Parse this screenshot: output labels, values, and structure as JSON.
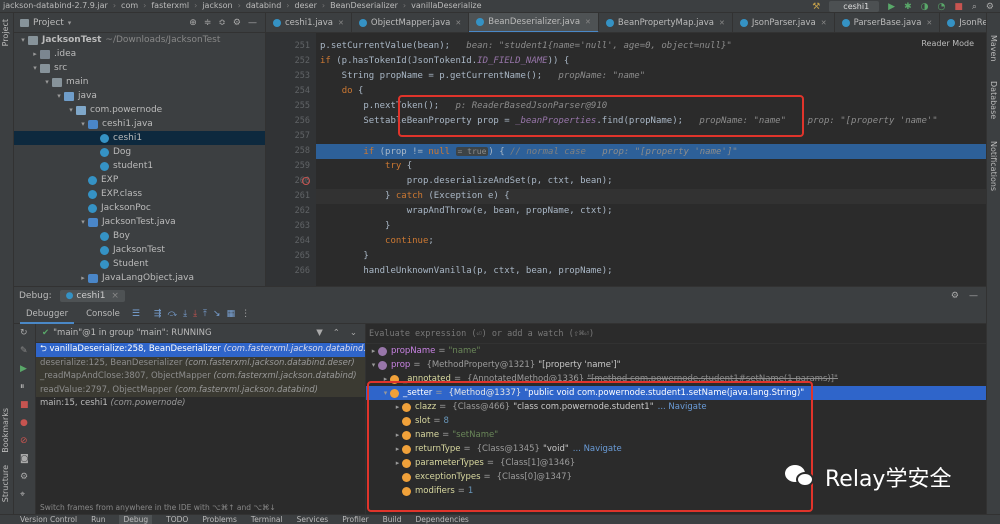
{
  "breadcrumb": [
    "jackson-databind-2.7.9.jar",
    "com",
    "fasterxml",
    "jackson",
    "databind",
    "deser",
    "BeanDeserializer",
    "vanillaDeserialize"
  ],
  "toolbar": {
    "run_config": "ceshi1"
  },
  "left_strip": {
    "project_label": "Project",
    "bookmarks_label": "Bookmarks",
    "structure_label": "Structure"
  },
  "right_strip": {
    "maven_label": "Maven",
    "database_label": "Database",
    "notifications_label": "Notifications"
  },
  "project": {
    "title": "Project",
    "tree": [
      {
        "label": "JacksonTest",
        "suffix": "~/Downloads/JacksonTest",
        "indent": 0,
        "arrow": "▾",
        "icon": "folder"
      },
      {
        "label": ".idea",
        "indent": 1,
        "arrow": "▸",
        "icon": "folder-idea"
      },
      {
        "label": "src",
        "indent": 1,
        "arrow": "▾",
        "icon": "folder"
      },
      {
        "label": "main",
        "indent": 2,
        "arrow": "▾",
        "icon": "folder"
      },
      {
        "label": "java",
        "indent": 3,
        "arrow": "▾",
        "icon": "folder-src"
      },
      {
        "label": "com.powernode",
        "indent": 4,
        "arrow": "▾",
        "icon": "pkg"
      },
      {
        "label": "ceshi1.java",
        "indent": 5,
        "arrow": "▾",
        "icon": "cls-j"
      },
      {
        "label": "ceshi1",
        "indent": 6,
        "arrow": "",
        "icon": "cls",
        "selected": true
      },
      {
        "label": "Dog",
        "indent": 6,
        "arrow": "",
        "icon": "cls"
      },
      {
        "label": "student1",
        "indent": 6,
        "arrow": "",
        "icon": "cls"
      },
      {
        "label": "EXP",
        "indent": 5,
        "arrow": "",
        "icon": "cls"
      },
      {
        "label": "EXP.class",
        "indent": 5,
        "arrow": "",
        "icon": "cls"
      },
      {
        "label": "JacksonPoc",
        "indent": 5,
        "arrow": "",
        "icon": "cls"
      },
      {
        "label": "JacksonTest.java",
        "indent": 5,
        "arrow": "▾",
        "icon": "cls-j"
      },
      {
        "label": "Boy",
        "indent": 6,
        "arrow": "",
        "icon": "cls"
      },
      {
        "label": "JacksonTest",
        "indent": 6,
        "arrow": "",
        "icon": "cls"
      },
      {
        "label": "Student",
        "indent": 6,
        "arrow": "",
        "icon": "cls"
      },
      {
        "label": "JavaLangObject.java",
        "indent": 5,
        "arrow": "▸",
        "icon": "cls-j"
      }
    ]
  },
  "editor_tabs": [
    "ceshi1.java",
    "ObjectMapper.java",
    "BeanDeserializer.java",
    "BeanPropertyMap.java",
    "JsonParser.java",
    "ParserBase.java",
    "JsonReadContext.ja"
  ],
  "editor": {
    "reader_mode": "Reader Mode",
    "lines": [
      {
        "n": "251",
        "segs": [
          [
            "p.setCurrentValue(bean);",
            "plain"
          ],
          [
            "   bean: \"student1{name='null', age=0, object=null}\"",
            "hint"
          ]
        ]
      },
      {
        "n": "252",
        "segs": [
          [
            "if",
            "kw"
          ],
          [
            " (p.hasTokenId(JsonTokenId.",
            "plain"
          ],
          [
            "ID_FIELD_NAME",
            "fld"
          ],
          [
            ")) {",
            "plain"
          ]
        ]
      },
      {
        "n": "253",
        "segs": [
          [
            "    String propName = p.getCurrentName();",
            "plain"
          ],
          [
            "   propName: \"name\"",
            "hint"
          ]
        ]
      },
      {
        "n": "254",
        "segs": [
          [
            "    ",
            "plain"
          ],
          [
            "do",
            "kw"
          ],
          [
            " {",
            "plain"
          ]
        ]
      },
      {
        "n": "255",
        "segs": [
          [
            "        p.nextToken();",
            "plain"
          ],
          [
            "   p: ReaderBasedJsonParser@910",
            "hint"
          ]
        ]
      },
      {
        "n": "256",
        "segs": [
          [
            "        SettableBeanProperty prop = ",
            "plain"
          ],
          [
            "_beanProperties",
            "fld"
          ],
          [
            ".find(propName);",
            "plain"
          ],
          [
            "   propName: \"name\"    prop: \"[property 'name'\"",
            "hint"
          ]
        ]
      },
      {
        "n": "257",
        "segs": []
      },
      {
        "n": "258",
        "exec": true,
        "segs": [
          [
            "        ",
            "plain"
          ],
          [
            "if",
            "kw"
          ],
          [
            " (prop != ",
            "plain"
          ],
          [
            "null",
            "kw"
          ],
          [
            " ",
            "plain"
          ],
          [
            "= true",
            "inlay"
          ],
          [
            ") { ",
            "plain"
          ],
          [
            "// normal case",
            "cmt"
          ],
          [
            "   prop: \"[property 'name']\"",
            "hint"
          ]
        ]
      },
      {
        "n": "259",
        "segs": [
          [
            "            ",
            "plain"
          ],
          [
            "try",
            "kw"
          ],
          [
            " {",
            "plain"
          ]
        ]
      },
      {
        "n": "260",
        "bp": true,
        "segs": [
          [
            "                prop.deserializeAndSet(p, ctxt, bean);",
            "plain"
          ]
        ]
      },
      {
        "n": "261",
        "cur": true,
        "segs": [
          [
            "            } ",
            "plain"
          ],
          [
            "catch",
            "kw"
          ],
          [
            " (Exception e) {",
            "plain"
          ]
        ]
      },
      {
        "n": "262",
        "segs": [
          [
            "                wrapAndThrow(e, bean, propName, ctxt);",
            "plain"
          ]
        ]
      },
      {
        "n": "263",
        "segs": [
          [
            "            }",
            "plain"
          ]
        ]
      },
      {
        "n": "264",
        "segs": [
          [
            "            ",
            "plain"
          ],
          [
            "continue",
            "kw"
          ],
          [
            ";",
            "plain"
          ]
        ]
      },
      {
        "n": "265",
        "segs": [
          [
            "        }",
            "plain"
          ]
        ]
      },
      {
        "n": "266",
        "segs": [
          [
            "        handleUnknownVanilla(p, ctxt, bean, propName);",
            "plain"
          ]
        ]
      }
    ]
  },
  "debug": {
    "title": "Debug:",
    "session": "ceshi1",
    "tabs": [
      "Debugger",
      "Console"
    ],
    "thread": "\"main\"@1 in group \"main\": RUNNING",
    "frames": [
      {
        "method": "vanillaDeserialize:258, BeanDeserializer",
        "pkg": "(com.fasterxml.jackson.databind.deser)",
        "kind": "sel"
      },
      {
        "method": "deserialize:125, BeanDeserializer",
        "pkg": "(com.fasterxml.jackson.databind.deser)",
        "kind": "lib"
      },
      {
        "method": "_readMapAndClose:3807, ObjectMapper",
        "pkg": "(com.fasterxml.jackson.databind)",
        "kind": "lib"
      },
      {
        "method": "readValue:2797, ObjectMapper",
        "pkg": "(com.fasterxml.jackson.databind)",
        "kind": "lib"
      },
      {
        "method": "main:15, ceshi1",
        "pkg": "(com.powernode)",
        "kind": "normal"
      }
    ],
    "switch_hint": "Switch frames from anywhere in the IDE with ⌥⌘↑ and ⌥⌘↓",
    "eval_placeholder": "Evaluate expression (⏎) or add a watch (⇧⌘⏎)",
    "variables": [
      {
        "indent": 0,
        "arrow": "▸",
        "icon": "p",
        "name": "propName",
        "ref": "",
        "value": "\"name\"",
        "vtype": "str"
      },
      {
        "indent": 0,
        "arrow": "▾",
        "icon": "p",
        "name": "prop",
        "ref": "{MethodProperty@1321}",
        "value": "\"[property 'name']\"",
        "vtype": "val"
      },
      {
        "indent": 1,
        "arrow": "▸",
        "icon": "f",
        "name": "_annotated",
        "ref": "{AnnotatedMethod@1336}",
        "value": "\"[method com.powernode.student1#setName(1 params)]\"",
        "vtype": "strike"
      },
      {
        "indent": 1,
        "arrow": "▾",
        "icon": "f",
        "name": "_setter",
        "ref": "{Method@1337}",
        "value": "\"public void com.powernode.student1.setName(java.lang.String)\"",
        "vtype": "val"
      },
      {
        "indent": 2,
        "arrow": "▸",
        "icon": "f",
        "name": "clazz",
        "ref": "{Class@466}",
        "value": "\"class com.powernode.student1\"",
        "vtype": "val",
        "nav": "... Navigate"
      },
      {
        "indent": 2,
        "arrow": "",
        "icon": "f",
        "name": "slot",
        "ref": "",
        "value": "8",
        "vtype": "num"
      },
      {
        "indent": 2,
        "arrow": "▸",
        "icon": "f",
        "name": "name",
        "ref": "",
        "value": "\"setName\"",
        "vtype": "str"
      },
      {
        "indent": 2,
        "arrow": "▸",
        "icon": "f",
        "name": "returnType",
        "ref": "{Class@1345}",
        "value": "\"void\"",
        "vtype": "val",
        "nav": "... Navigate"
      },
      {
        "indent": 2,
        "arrow": "▸",
        "icon": "f",
        "name": "parameterTypes",
        "ref": "{Class[1]@1346}",
        "value": "",
        "vtype": "val"
      },
      {
        "indent": 2,
        "arrow": "",
        "icon": "f",
        "name": "exceptionTypes",
        "ref": "{Class[0]@1347}",
        "value": "",
        "vtype": "val"
      },
      {
        "indent": 2,
        "arrow": "",
        "icon": "f",
        "name": "modifiers",
        "ref": "",
        "value": "1",
        "vtype": "num"
      }
    ]
  },
  "watermark": {
    "text": "Relay学安全"
  },
  "statusbar": [
    "Version Control",
    "Run",
    "Debug",
    "TODO",
    "Problems",
    "Terminal",
    "Services",
    "Profiler",
    "Build",
    "Dependencies"
  ],
  "colors": {
    "accent": "#2f65ca",
    "highlight_box": "#e0342b",
    "exec_line": "#2d6099"
  }
}
